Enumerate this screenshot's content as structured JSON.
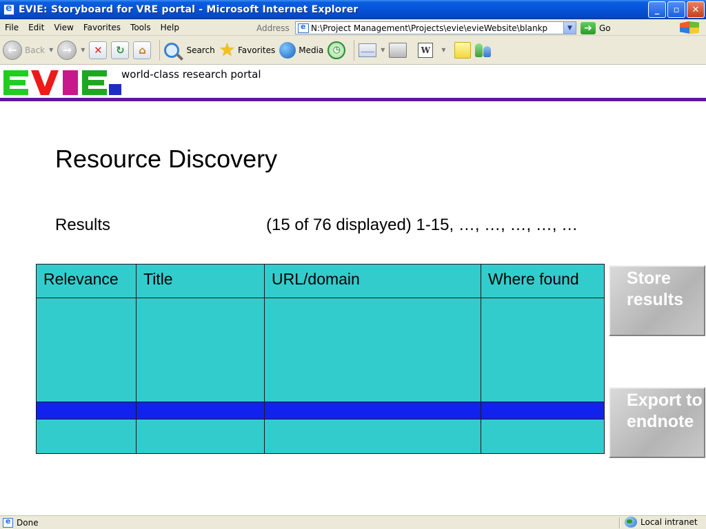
{
  "window": {
    "title": "EVIE: Storyboard for VRE portal - Microsoft Internet Explorer",
    "controls": {
      "minimize": "_",
      "restore": "▫",
      "close": "✕"
    }
  },
  "menu": {
    "items": [
      "File",
      "Edit",
      "View",
      "Favorites",
      "Tools",
      "Help"
    ],
    "address_label": "Address",
    "address_value": "N:\\Project Management\\Projects\\evie\\evieWebsite\\blankp",
    "go_label": "Go"
  },
  "toolbar": {
    "back_label": "Back",
    "search_label": "Search",
    "favorites_label": "Favorites",
    "media_label": "Media",
    "icons": [
      "back-arrow-icon",
      "forward-arrow-icon",
      "stop-icon",
      "refresh-icon",
      "home-icon",
      "search-icon",
      "favorites-star-icon",
      "media-icon",
      "history-icon",
      "mail-icon",
      "print-icon",
      "word-edit-icon",
      "discuss-note-icon",
      "messenger-icon"
    ]
  },
  "header": {
    "logo_text": "EVIE",
    "logo_colors": {
      "e": "#22cc22",
      "v": "#ee1a1a",
      "i": "#c9188b",
      "e2": "#1fa81f",
      "dot": "#1c2ec4"
    },
    "tagline": "world-class research portal",
    "rule_color": "#5a189a"
  },
  "content": {
    "title": "Resource Discovery",
    "results_label": "Results",
    "results_count": "(15 of 76 displayed) 1-15, …, …, …, …, …"
  },
  "table": {
    "headers": [
      "Relevance",
      "Title",
      "URL/domain",
      "Where found"
    ],
    "body_color": "#33cccc",
    "highlight_color": "#1122ee"
  },
  "actions": {
    "store_label": "Store results",
    "export_label": "Export to endnote"
  },
  "status": {
    "text": "Done",
    "zone": "Local intranet"
  }
}
